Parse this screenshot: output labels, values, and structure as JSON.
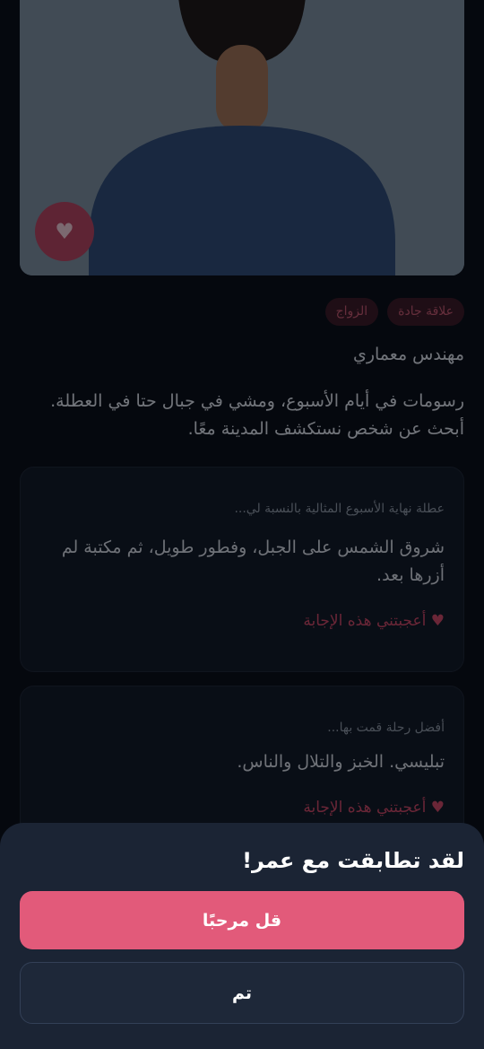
{
  "profile": {
    "like_icon": "heart-icon",
    "tags": [
      "علاقة جادة",
      "الزواج"
    ],
    "job": "مهندس معماري",
    "bio": "رسومات في أيام الأسبوع، ومشي في جبال حتا في العطلة. أبحث عن شخص نستكشف المدينة معًا."
  },
  "prompts": [
    {
      "question": "عطلة نهاية الأسبوع المثالية بالنسبة لي...",
      "answer": "شروق الشمس على الجبل، وفطور طويل، ثم مكتبة لم أزرها بعد.",
      "like_label": "♥ أعجبتني هذه الإجابة"
    },
    {
      "question": "أفضل رحلة قمت بها...",
      "answer": "تبليسي. الخبز والتلال والناس.",
      "like_label": "♥ أعجبتني هذه الإجابة"
    }
  ],
  "match_sheet": {
    "title": "لقد تطابقت مع عمر!",
    "primary_label": "قل مرحبًا",
    "secondary_label": "تم"
  },
  "colors": {
    "accent": "#e25a7a",
    "sheet_bg": "#1b2434",
    "background": "#070b11"
  }
}
